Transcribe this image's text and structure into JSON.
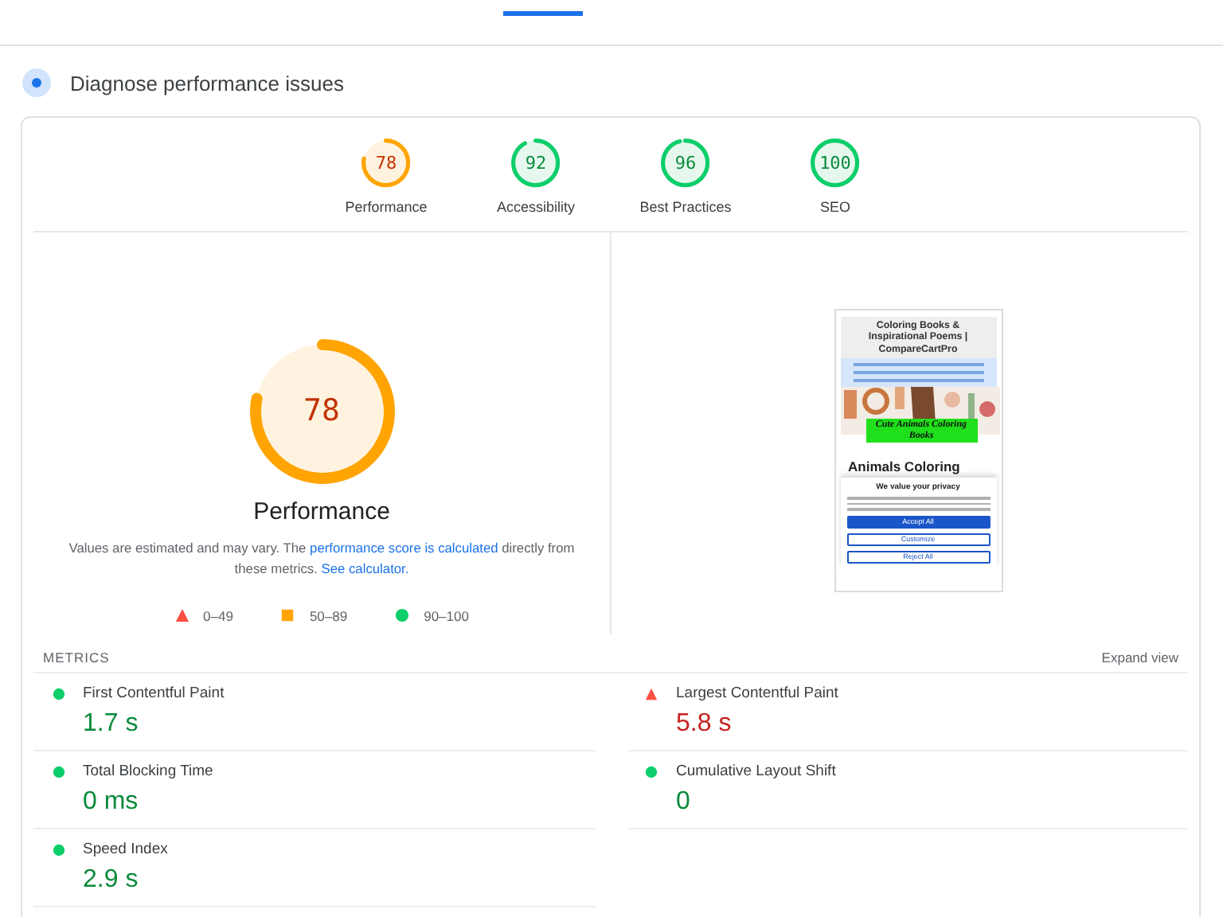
{
  "section": {
    "title": "Diagnose performance issues"
  },
  "categories": [
    {
      "score": "78",
      "label": "Performance",
      "kind": "average"
    },
    {
      "score": "92",
      "label": "Accessibility",
      "kind": "pass"
    },
    {
      "score": "96",
      "label": "Best Practices",
      "kind": "pass"
    },
    {
      "score": "100",
      "label": "SEO",
      "kind": "pass"
    }
  ],
  "main_gauge": {
    "score": "78",
    "label": "Performance",
    "kind": "average"
  },
  "description": {
    "before": "Values are estimated and may vary. The ",
    "link1": "performance score is calculated",
    "middle": " directly from these metrics. ",
    "link2": "See calculator."
  },
  "legend": [
    {
      "kind": "fail",
      "range": "0–49"
    },
    {
      "kind": "average",
      "range": "50–89"
    },
    {
      "kind": "pass",
      "range": "90–100"
    }
  ],
  "screenshot": {
    "site_title": "Coloring Books & Inspirational Poems | CompareCartPro",
    "banner": "Cute Animals Coloring Books",
    "heading": "Animals Coloring",
    "dialog_title": "We value your privacy",
    "buttons": [
      {
        "label": "Accept All",
        "kind": "primary"
      },
      {
        "label": "Customize",
        "kind": "outline"
      },
      {
        "label": "Reject All",
        "kind": "outline"
      }
    ]
  },
  "metrics_header": {
    "title": "METRICS",
    "expand": "Expand view"
  },
  "metrics": [
    {
      "name": "First Contentful Paint",
      "value": "1.7 s",
      "kind": "pass"
    },
    {
      "name": "Largest Contentful Paint",
      "value": "5.8 s",
      "kind": "fail"
    },
    {
      "name": "Total Blocking Time",
      "value": "0 ms",
      "kind": "pass"
    },
    {
      "name": "Cumulative Layout Shift",
      "value": "0",
      "kind": "pass"
    },
    {
      "name": "Speed Index",
      "value": "2.9 s",
      "kind": "pass"
    }
  ]
}
